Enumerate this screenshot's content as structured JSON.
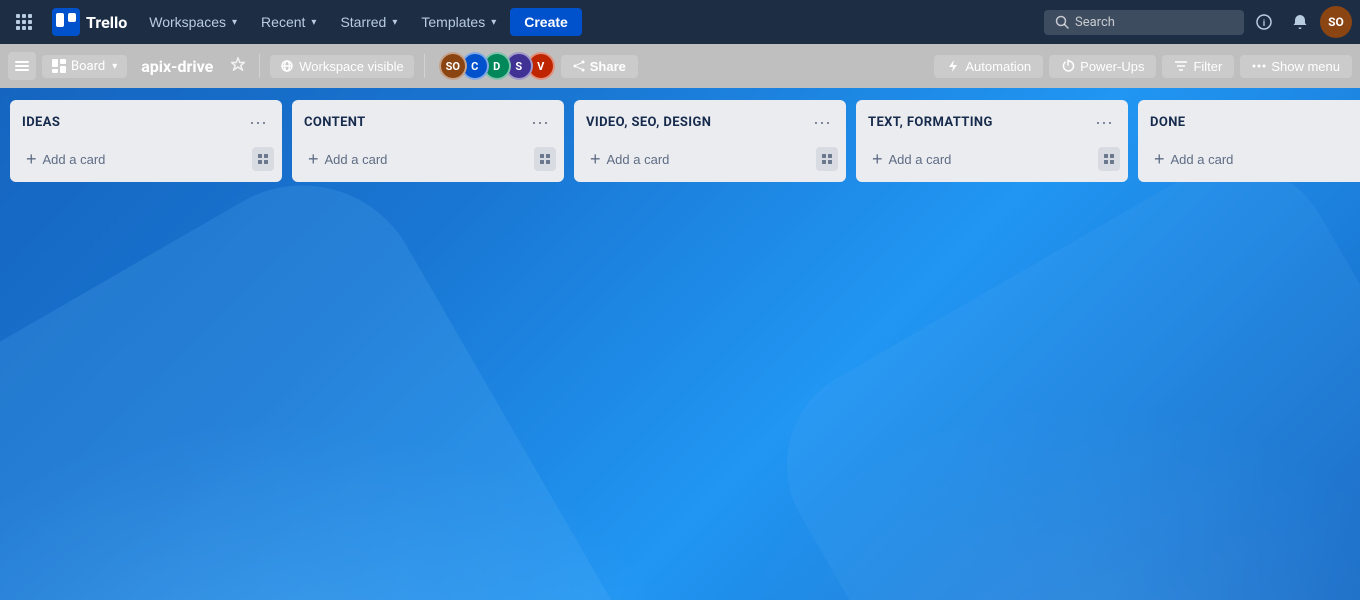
{
  "topNav": {
    "logoText": "Trello",
    "workspacesLabel": "Workspaces",
    "recentLabel": "Recent",
    "starredLabel": "Starred",
    "templatesLabel": "Templates",
    "createLabel": "Create",
    "searchPlaceholder": "Search",
    "infoIcon": "ℹ",
    "notifIcon": "🔔",
    "userInitials": "SO"
  },
  "boardNav": {
    "boardType": "Board",
    "boardName": "apix-drive",
    "boardLinkName": "apix-drive",
    "workspaceVisible": "Workspace visible",
    "shareLabel": "Share",
    "automationLabel": "Automation",
    "powerUpsLabel": "Power-Ups",
    "filterLabel": "Filter",
    "showMenuLabel": "Show menu",
    "members": [
      {
        "initials": "SO",
        "color": "#8b4513"
      },
      {
        "initials": "C",
        "color": "#0052cc"
      },
      {
        "initials": "D",
        "color": "#00875a"
      },
      {
        "initials": "S",
        "color": "#403294"
      },
      {
        "initials": "V",
        "color": "#bf2600"
      }
    ]
  },
  "lists": [
    {
      "id": "ideas",
      "title": "IDEAS",
      "addCardLabel": "Add a card"
    },
    {
      "id": "content",
      "title": "CONTENT",
      "addCardLabel": "Add a card"
    },
    {
      "id": "video-seo-design",
      "title": "VIDEO, SEO, DESIGN",
      "addCardLabel": "Add a card"
    },
    {
      "id": "text-formatting",
      "title": "TEXT, FORMATTING",
      "addCardLabel": "Add a card"
    },
    {
      "id": "done",
      "title": "DONE",
      "addCardLabel": "Add a card"
    }
  ]
}
